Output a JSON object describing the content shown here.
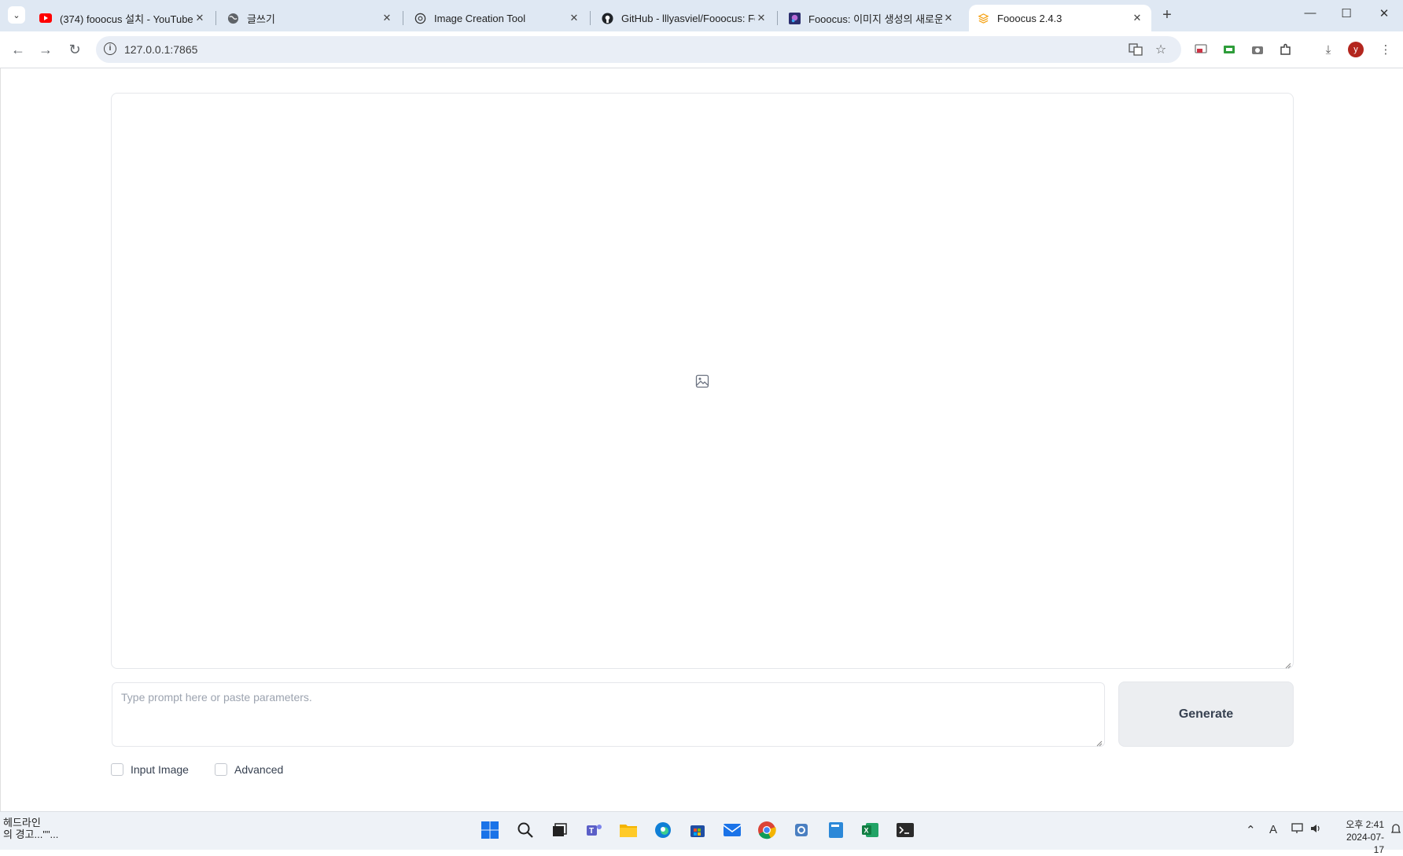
{
  "browser": {
    "tabs": [
      {
        "title": "(374) fooocus 설치 - YouTube",
        "favicon": "youtube-icon",
        "active": false
      },
      {
        "title": "글쓰기",
        "favicon": "globe-icon",
        "active": false
      },
      {
        "title": "Image Creation Tool",
        "favicon": "openai-icon",
        "active": false
      },
      {
        "title": "GitHub - lllyasviel/Fooocus: Fo",
        "favicon": "github-icon",
        "active": false
      },
      {
        "title": "Fooocus: 이미지 생성의 새로운",
        "favicon": "article-icon",
        "active": false
      },
      {
        "title": "Fooocus 2.4.3",
        "favicon": "gradio-icon",
        "active": true
      }
    ],
    "url": "127.0.0.1:7865",
    "profile_initial": "y",
    "accent_color": "#b3261e"
  },
  "app": {
    "gallery_placeholder_icon": "image-icon",
    "prompt_placeholder": "Type prompt here or paste parameters.",
    "generate_label": "Generate",
    "checkboxes": [
      {
        "label": "Input Image",
        "checked": false
      },
      {
        "label": "Advanced",
        "checked": false
      }
    ]
  },
  "taskbar": {
    "news_line1": "헤드라인",
    "news_line2": "의 경고...\"\"...",
    "clock_time": "오후 2:41",
    "clock_date": "2024-07-17",
    "tray_ime": "A"
  }
}
